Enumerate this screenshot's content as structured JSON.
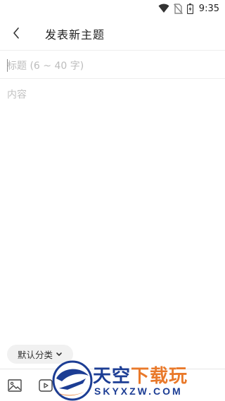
{
  "status_bar": {
    "time": "9:35",
    "icons": [
      "wifi-icon",
      "no-sim-icon",
      "battery-charging-icon"
    ]
  },
  "app_bar": {
    "back_icon": "chevron-left-icon",
    "title": "发表新主题"
  },
  "editor": {
    "title_placeholder": "标题 (6 ~ 40 字)",
    "content_placeholder": "内容"
  },
  "category": {
    "selected": "默认分类",
    "icon": "chevron-down-icon"
  },
  "toolbar": {
    "icons": [
      "image-icon",
      "video-icon"
    ]
  },
  "watermark": {
    "chinese_main": "天空",
    "chinese_accent": "下载玩",
    "english": "SKYXZW.COM"
  },
  "colors": {
    "watermark_blue": "#1c3d94",
    "watermark_orange": "#e9792a",
    "placeholder_gray": "#bcbcbc"
  }
}
